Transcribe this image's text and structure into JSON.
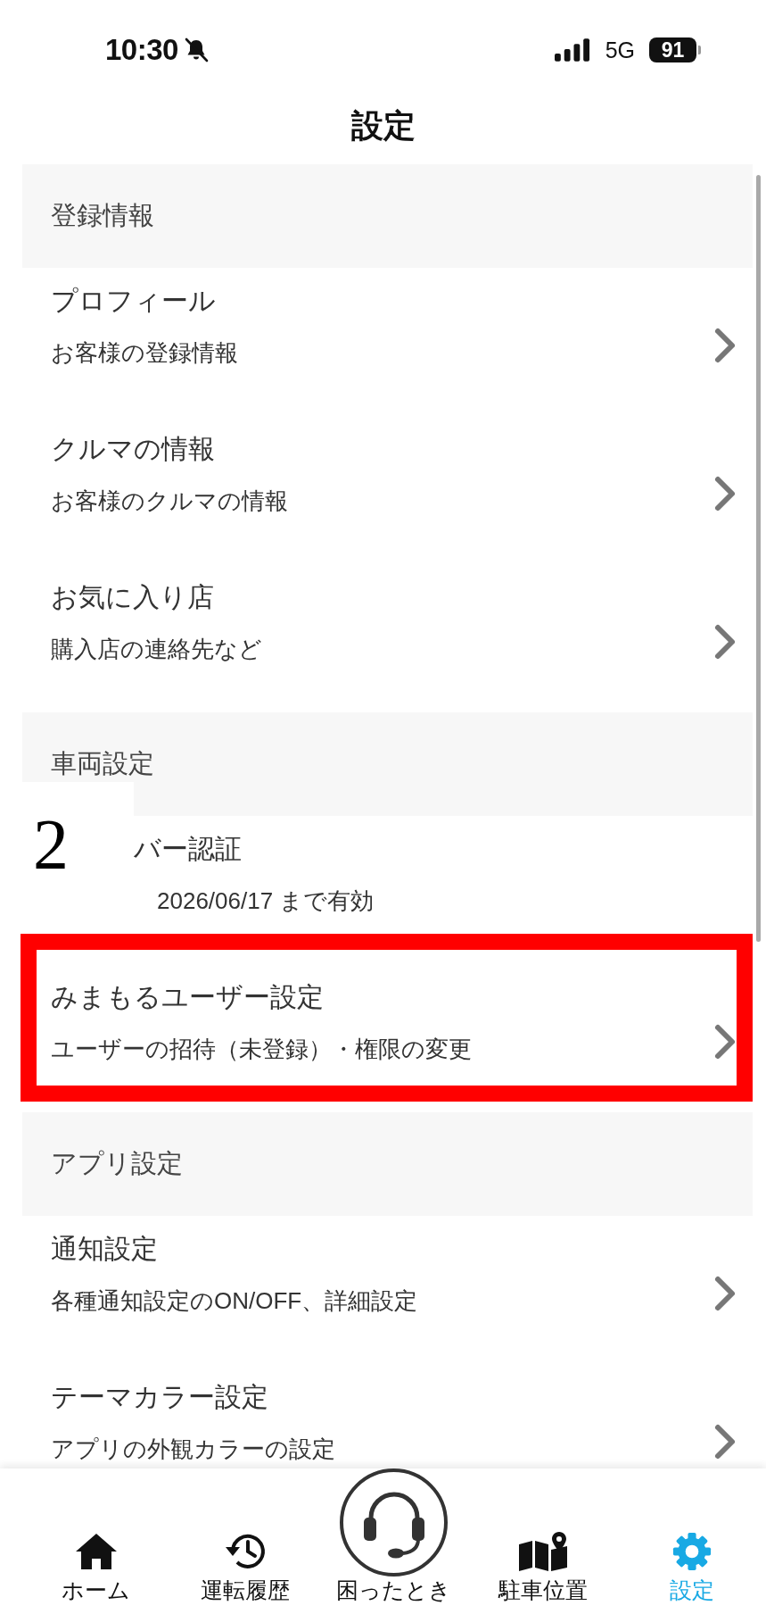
{
  "status_bar": {
    "time": "10:30",
    "silent": true,
    "network": "5G",
    "battery": "91"
  },
  "header": {
    "title": "設定"
  },
  "sections": [
    {
      "title": "登録情報",
      "rows": [
        {
          "kind": "link",
          "title": "プロフィール",
          "subtitle": "お客様の登録情報",
          "highlighted": false
        },
        {
          "kind": "link",
          "title": "クルマの情報",
          "subtitle": "お客様のクルマの情報",
          "highlighted": false
        },
        {
          "kind": "link",
          "title": "お気に入り店",
          "subtitle": "購入店の連絡先など",
          "highlighted": false
        }
      ]
    },
    {
      "title": "車両設定",
      "rows": [
        {
          "kind": "info",
          "title": "バー認証",
          "subtitle": "2026/06/17 まで有効",
          "highlighted": false,
          "overlay_label": "2"
        },
        {
          "kind": "link",
          "title": "みまもるユーザー設定",
          "subtitle": "ユーザーの招待（未登録）・権限の変更",
          "highlighted": true
        }
      ]
    },
    {
      "title": "アプリ設定",
      "rows": [
        {
          "kind": "link",
          "title": "通知設定",
          "subtitle": "各種通知設定のON/OFF、詳細設定",
          "highlighted": false
        },
        {
          "kind": "link",
          "title": "テーマカラー設定",
          "subtitle": "アプリの外観カラーの設定",
          "highlighted": false
        }
      ]
    }
  ],
  "tab_bar": [
    {
      "label": "ホーム",
      "kind": "normal",
      "selected": false
    },
    {
      "label": "運転履歴",
      "kind": "normal",
      "selected": false
    },
    {
      "label": "困ったとき",
      "kind": "raised",
      "selected": false
    },
    {
      "label": "駐車位置",
      "kind": "normal",
      "selected": false
    },
    {
      "label": "設定",
      "kind": "normal",
      "selected": true
    }
  ]
}
